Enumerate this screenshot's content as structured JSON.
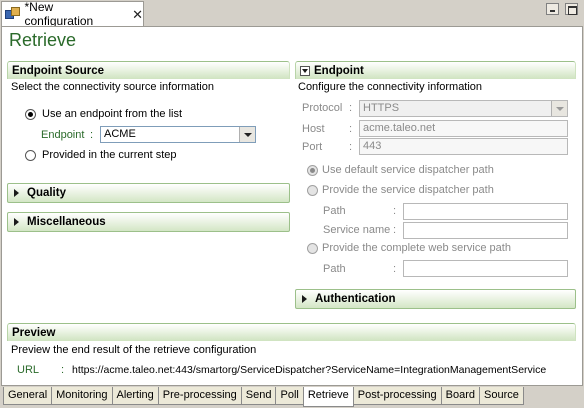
{
  "editor_tab": {
    "title": "*New configuration",
    "close": "✕"
  },
  "page": {
    "title": "Retrieve"
  },
  "endpoint_source": {
    "header": "Endpoint Source",
    "description": "Select the connectivity source information",
    "option_list": "Use an endpoint from the list",
    "endpoint_label": "Endpoint",
    "endpoint_colon": ":",
    "endpoint_value": "ACME",
    "option_current": "Provided in the current step"
  },
  "quality": {
    "header": "Quality"
  },
  "miscellaneous": {
    "header": "Miscellaneous"
  },
  "endpoint": {
    "header": "Endpoint",
    "description": "Configure the connectivity information",
    "protocol_label": "Protocol",
    "protocol_value": "HTTPS",
    "host_label": "Host",
    "host_value": "acme.taleo.net",
    "port_label": "Port",
    "port_value": "443",
    "colon": ":",
    "opt_default": "Use default service dispatcher path",
    "opt_provide": "Provide the service dispatcher path",
    "path_label": "Path",
    "service_name_label": "Service name",
    "opt_complete": "Provide the complete web service path",
    "path2_label": "Path"
  },
  "authentication": {
    "header": "Authentication"
  },
  "preview": {
    "header": "Preview",
    "description": "Preview the end result of the retrieve configuration",
    "url_label": "URL",
    "colon": ":",
    "url_value": "https://acme.taleo.net:443/smartorg/ServiceDispatcher?ServiceName=IntegrationManagementService"
  },
  "bottom_tabs": [
    "General",
    "Monitoring",
    "Alerting",
    "Pre-processing",
    "Send",
    "Poll",
    "Retrieve",
    "Post-processing",
    "Board",
    "Source"
  ],
  "active_tab": "Retrieve",
  "colors": {
    "title_green": "#2a6a2a",
    "header_green": "#cfe3c0"
  }
}
